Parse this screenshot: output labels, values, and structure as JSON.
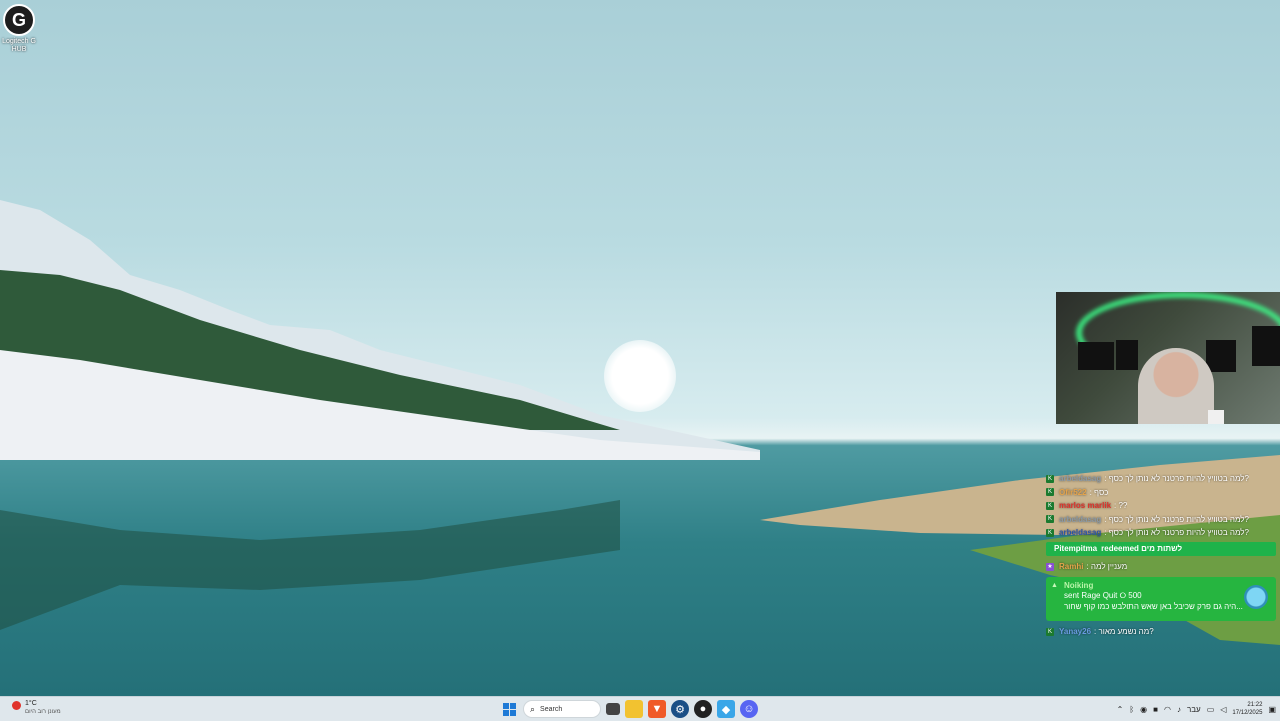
{
  "desktop": {
    "icon_label": "Logitech G HUB",
    "icon_glyph": "G"
  },
  "chat": {
    "messages": [
      {
        "user": "arbeldasag",
        "user_color": "#8a9aa8",
        "text": ": למה בטוויץ להיות פרטנר לא נותן לך כסף?"
      },
      {
        "user": "Ofir522",
        "user_color": "#e4a34a",
        "text": ": כסף"
      },
      {
        "user": "marlos marlik",
        "user_color": "#e0302a",
        "text": ": ??"
      },
      {
        "user": "arbeldasag",
        "user_color": "#8a9aa8",
        "text": ": למה בטוויץ להיות פרטנר לא נותן לך כסף?"
      },
      {
        "user": "arbeldasag",
        "user_color": "#2a54a8",
        "text": ": למה בטוויץ להיות פרטנר לא נותן לך כסף?"
      }
    ],
    "redeem": {
      "user": "Pitempitma",
      "text": "redeemed לשתות מים"
    },
    "msg_after_redeem": {
      "user": "Ramhi",
      "user_color": "#e4a34a",
      "text": ": מעניין למה"
    },
    "alert": {
      "name": "Noiking",
      "line1": "sent Rage Quit",
      "amount": "500",
      "line2": "היה גם פרק שכיבל באן שאש התולבש כמו קוף שחור..."
    },
    "last_message": {
      "user": "Yanay26",
      "user_color": "#6a9ae0",
      "text": ": מה נשמע מאור?"
    }
  },
  "taskbar": {
    "weather_temp": "1°C",
    "weather_desc": "מעונן רוב היום",
    "search_label": "Search",
    "language": "עבר",
    "time": "21:22",
    "date": "17/12/2025"
  },
  "colors": {
    "redeem_bg": "#1fb34a",
    "alert_bg": "#26b540",
    "webcam_glow": "#3dff8a"
  }
}
